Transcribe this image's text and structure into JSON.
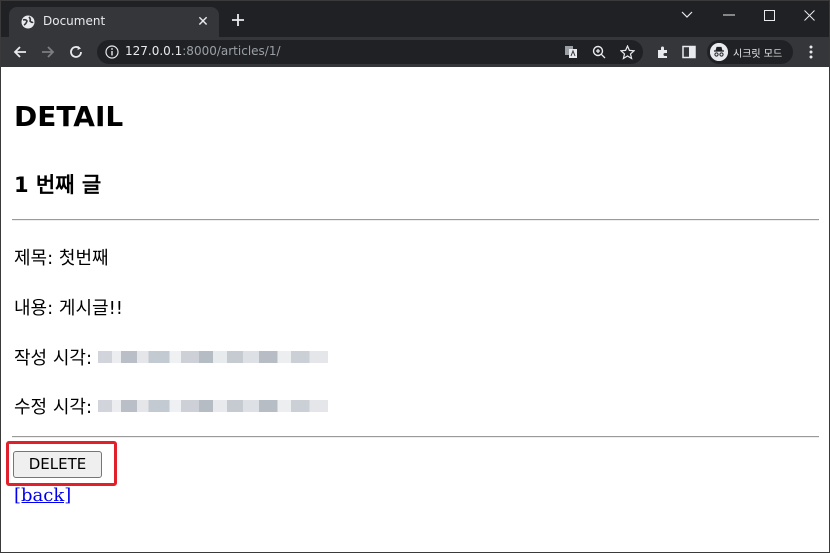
{
  "browser": {
    "tab_title": "Document",
    "url_host": "127.0.0.1",
    "url_path": ":8000/articles/1/",
    "incognito_label": "시크릿 모드"
  },
  "page": {
    "heading": "DETAIL",
    "subheading": "1 번째 글",
    "title_line": "제목: 첫번째",
    "content_line": "내용: 게시글!!",
    "created_label": "작성 시각:",
    "updated_label": "수정 시각:",
    "delete_label": "DELETE",
    "back_label": "[back]"
  },
  "colors": {
    "highlight_box": "#e0202a",
    "link": "#0000ee"
  }
}
